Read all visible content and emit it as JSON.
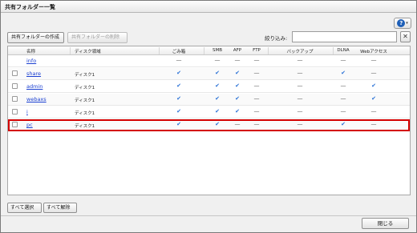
{
  "window": {
    "title": "共有フォルダー一覧"
  },
  "help": {
    "icon": "help-icon",
    "glyph": "?",
    "caret": "▾"
  },
  "toolbar": {
    "create_label": "共有フォルダーの作成",
    "delete_label": "共有フォルダーの削除",
    "filter_label": "絞り込み:",
    "filter_value": "",
    "clear_glyph": "✕"
  },
  "table": {
    "columns": {
      "name": "名称",
      "volume": "ディスク領域",
      "trash": "ごみ箱",
      "smb": "SMB",
      "afp": "AFP",
      "ftp": "FTP",
      "backup": "バックアップ",
      "dlna": "DLNA",
      "webaccess": "Webアクセス"
    },
    "rows": [
      {
        "name": "info",
        "checkbox": false,
        "volume": "",
        "trash": "dash",
        "smb": "dash",
        "afp": "dash",
        "ftp": "dash",
        "backup": "dash",
        "dlna": "dash",
        "webaccess": "dash"
      },
      {
        "name": "share",
        "checkbox": true,
        "volume": "ディスク1",
        "trash": "check",
        "smb": "check",
        "afp": "check",
        "ftp": "dash",
        "backup": "dash",
        "dlna": "check",
        "webaccess": "dash"
      },
      {
        "name": "admin",
        "checkbox": true,
        "volume": "ディスク1",
        "trash": "check",
        "smb": "check",
        "afp": "check",
        "ftp": "dash",
        "backup": "dash",
        "dlna": "dash",
        "webaccess": "check"
      },
      {
        "name": "webaxs",
        "checkbox": true,
        "volume": "ディスク1",
        "trash": "check",
        "smb": "check",
        "afp": "check",
        "ftp": "dash",
        "backup": "dash",
        "dlna": "dash",
        "webaccess": "check"
      },
      {
        "name": "i",
        "checkbox": true,
        "volume": "ディスク1",
        "trash": "check",
        "smb": "check",
        "afp": "check",
        "ftp": "dash",
        "backup": "dash",
        "dlna": "dash",
        "webaccess": "dash"
      },
      {
        "name": "pc",
        "checkbox": true,
        "volume": "ディスク1",
        "trash": "check",
        "smb": "check",
        "afp": "dash",
        "ftp": "dash",
        "backup": "dash",
        "dlna": "check",
        "webaccess": "dash",
        "highlighted": true
      }
    ]
  },
  "glyphs": {
    "check": "✔",
    "dash": "—"
  },
  "footer": {
    "select_all_label": "すべて選択",
    "clear_all_label": "すべて解除",
    "close_label": "閉じる"
  },
  "colors": {
    "check": "#2b72d6",
    "link": "#1a3fd1",
    "highlight": "#d40000",
    "help": "#1e5fb8"
  }
}
